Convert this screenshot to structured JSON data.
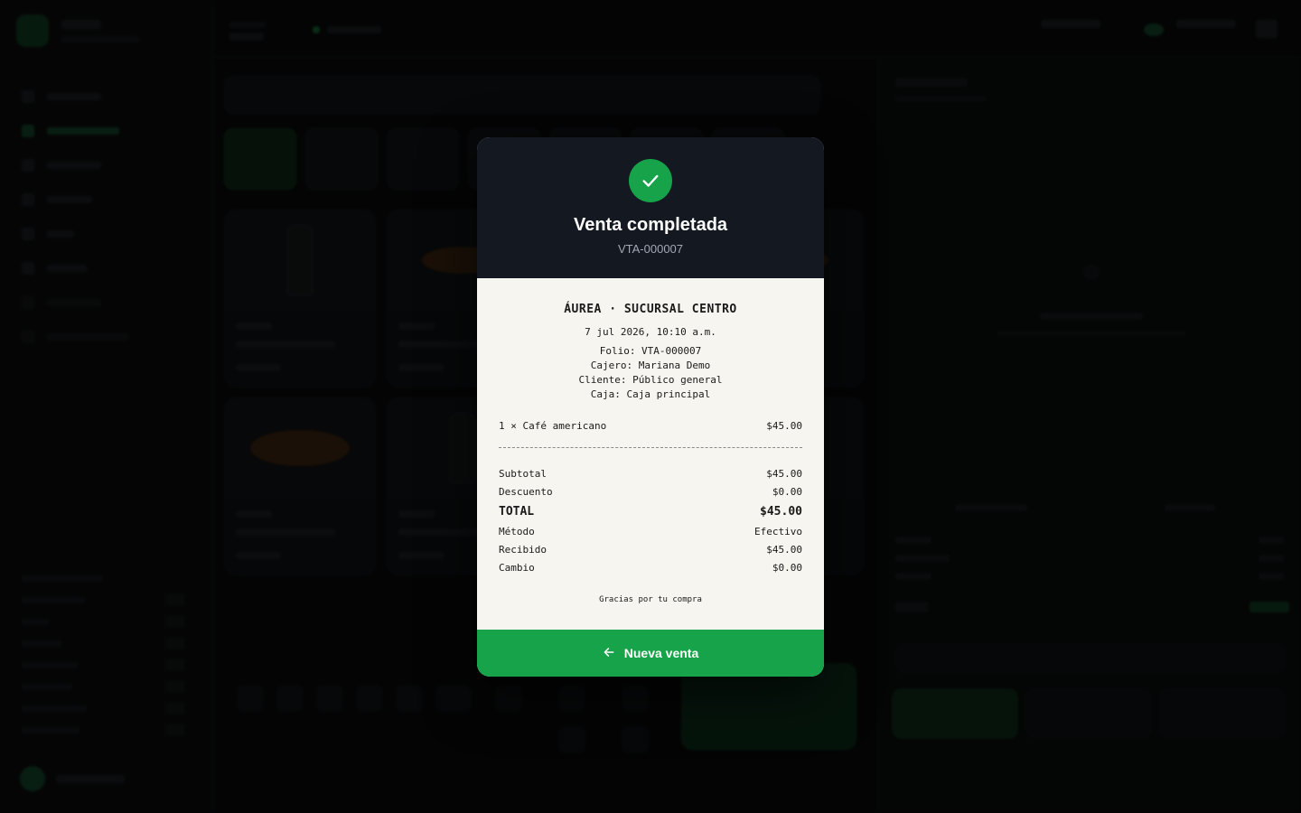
{
  "modal": {
    "title": "Venta completada",
    "folio": "VTA-000007",
    "button_label": "Nueva venta"
  },
  "receipt": {
    "store": "ÁUREA · SUCURSAL CENTRO",
    "datetime": "7 jul 2026, 10:10 a.m.",
    "folio_line": "Folio: VTA-000007",
    "cashier_line": "Cajero: Mariana Demo",
    "customer_line": "Cliente: Público general",
    "register_line": "Caja: Caja principal",
    "items": [
      {
        "desc": "1 × Café americano",
        "amount": "$45.00"
      }
    ],
    "subtotal_label": "Subtotal",
    "subtotal": "$45.00",
    "discount_label": "Descuento",
    "discount": "$0.00",
    "total_label": "TOTAL",
    "total": "$45.00",
    "method_label": "Método",
    "method": "Efectivo",
    "received_label": "Recibido",
    "received": "$45.00",
    "change_label": "Cambio",
    "change": "$0.00",
    "thanks": "Gracias por tu compra"
  },
  "colors": {
    "accent": "#16a34a",
    "modal_header": "#131821",
    "receipt_paper": "#f6f5f0"
  },
  "icons": {
    "success": "check-icon",
    "back": "arrow-left-icon"
  }
}
